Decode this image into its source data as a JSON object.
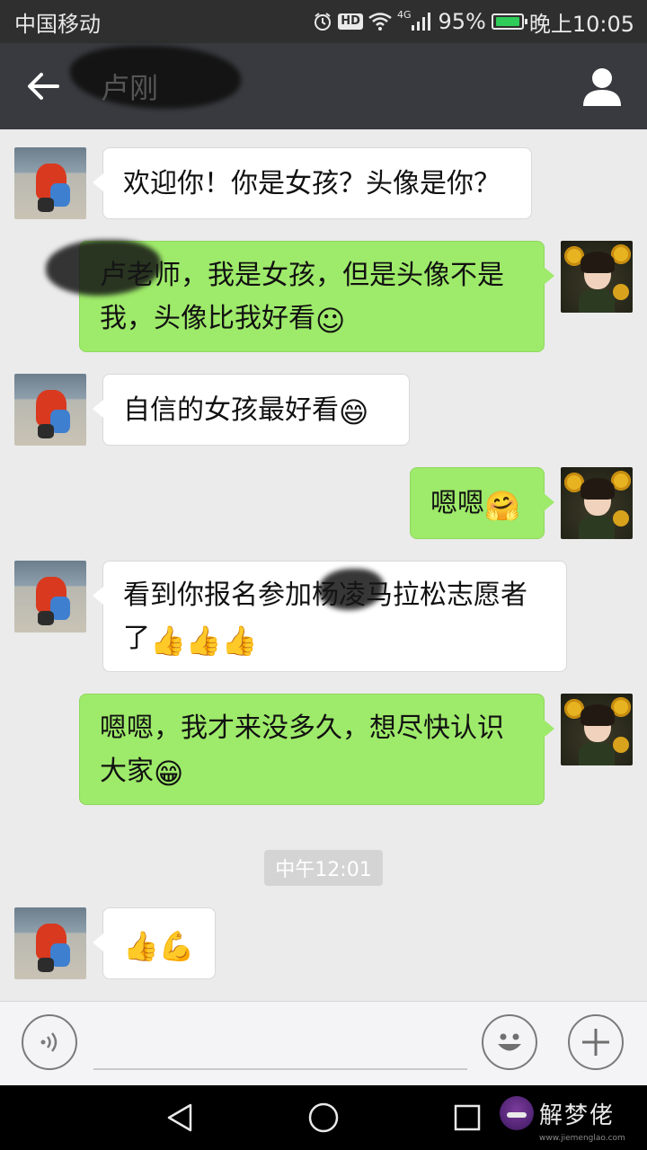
{
  "status_bar": {
    "carrier": "中国移动",
    "network": "4G",
    "hd": "HD",
    "battery_pct": "95%",
    "battery_level": 0.95,
    "time": "晚上10:05",
    "icons": [
      "alarm-icon",
      "hd-icon",
      "wifi-icon",
      "signal-icon",
      "battery-icon"
    ]
  },
  "header": {
    "title": "卢刚",
    "back_icon": "arrow-left-icon",
    "profile_icon": "person-icon"
  },
  "messages": [
    {
      "side": "left",
      "parts": [
        "欢迎你！你是女孩？头像是你？"
      ]
    },
    {
      "side": "right",
      "parts": [
        "卢老师，我是女孩，但是头像不是我，头像比我好看",
        "☺"
      ]
    },
    {
      "side": "left",
      "parts": [
        "自信的女孩最好看",
        "😄"
      ]
    },
    {
      "side": "right",
      "parts": [
        "嗯嗯",
        "🤗"
      ]
    },
    {
      "side": "left",
      "parts": [
        "看到你报名参加杨凌马拉松志愿者了",
        "👍👍👍"
      ]
    },
    {
      "side": "right",
      "parts": [
        "嗯嗯，我才来没多久，想尽快认识大家",
        "😁"
      ]
    },
    {
      "side": "left",
      "parts": [
        "👍💪"
      ]
    }
  ],
  "timestamp": "中午12:01",
  "input_bar": {
    "placeholder": "",
    "voice_icon": "voice-icon",
    "emoji_icon": "smiley-icon",
    "plus_icon": "plus-icon"
  },
  "nav_bar": {
    "back_icon": "triangle-back-icon",
    "home_icon": "circle-home-icon",
    "recent_icon": "square-recent-icon"
  },
  "watermark": {
    "text": "解梦佬",
    "url": "www.jiemenglao.com"
  }
}
